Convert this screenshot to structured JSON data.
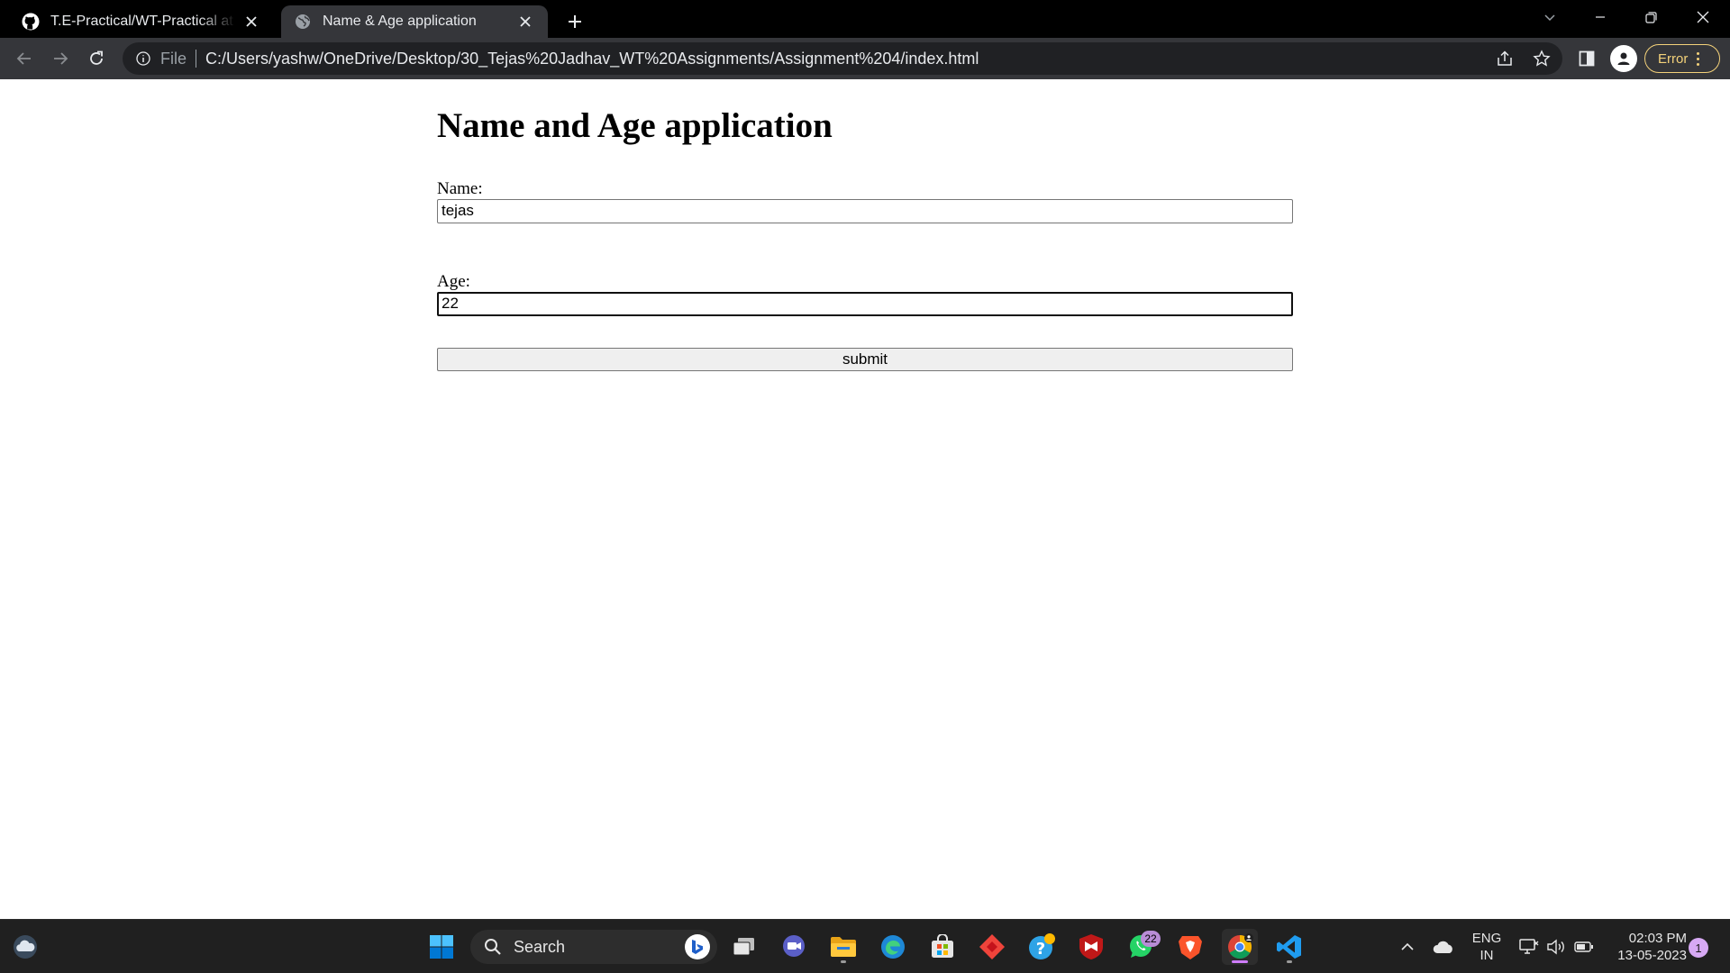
{
  "browser": {
    "tabs": [
      {
        "title": "T.E-Practical/WT-Practical at main",
        "icon": "github-icon",
        "active": false
      },
      {
        "title": "Name & Age application",
        "icon": "globe-icon",
        "active": true
      }
    ],
    "omnibox": {
      "scheme": "File",
      "url": "C:/Users/yashw/OneDrive/Desktop/30_Tejas%20Jadhav_WT%20Assignments/Assignment%204/index.html"
    },
    "error_label": "Error"
  },
  "page": {
    "heading": "Name and Age application",
    "name_label": "Name:",
    "name_value": "tejas",
    "age_label": "Age:",
    "age_value": "22",
    "submit_label": "submit"
  },
  "taskbar": {
    "search_label": "Search",
    "whatsapp_badge": "22",
    "lang_line1": "ENG",
    "lang_line2": "IN",
    "time": "02:03 PM",
    "date": "13-05-2023",
    "notification_count": "1"
  },
  "colors": {
    "tab_strip": "#000000",
    "toolbar": "#35363a",
    "omnibox": "#202124",
    "error_accent": "#f4d27a",
    "taskbar": "#202020"
  }
}
